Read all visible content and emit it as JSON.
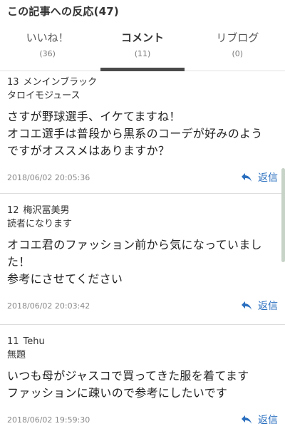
{
  "header": {
    "title": "この記事への反応(47)"
  },
  "tabs": [
    {
      "label": "いいね！",
      "count": "(36)",
      "active": false
    },
    {
      "label": "コメント",
      "count": "(11)",
      "active": true
    },
    {
      "label": "リブログ",
      "count": "(0)",
      "active": false
    }
  ],
  "comments": [
    {
      "number": "13",
      "author": "メンインブラック",
      "subject": "タロイモジュース",
      "body_lines": [
        "さすが野球選手、イケてますね！",
        "オコエ選手は普段から黒系のコーデが好みのよう",
        "ですがオススメはありますか？"
      ],
      "date": "2018/06/02 20:05:36",
      "reply_label": "返信"
    },
    {
      "number": "12",
      "author": "梅沢冨美男",
      "subject": "読者になります",
      "body_lines": [
        "オコエ君のファッション前から気になっていまし",
        "た！",
        "参考にさせてください"
      ],
      "date": "2018/06/02 20:03:42",
      "reply_label": "返信"
    },
    {
      "number": "11",
      "author": "Tehu",
      "subject": "無題",
      "body_lines": [
        "いつも母がジャスコで買ってきた服を着てます",
        "ファッションに疎いので参考にしたいです"
      ],
      "date": "2018/06/02 19:59:30",
      "reply_label": "返信"
    }
  ],
  "icons": {
    "reply": "reply-arrow-icon"
  },
  "colors": {
    "accent": "#2a6fbf",
    "active_tab_bar": "#4a4a4a"
  }
}
